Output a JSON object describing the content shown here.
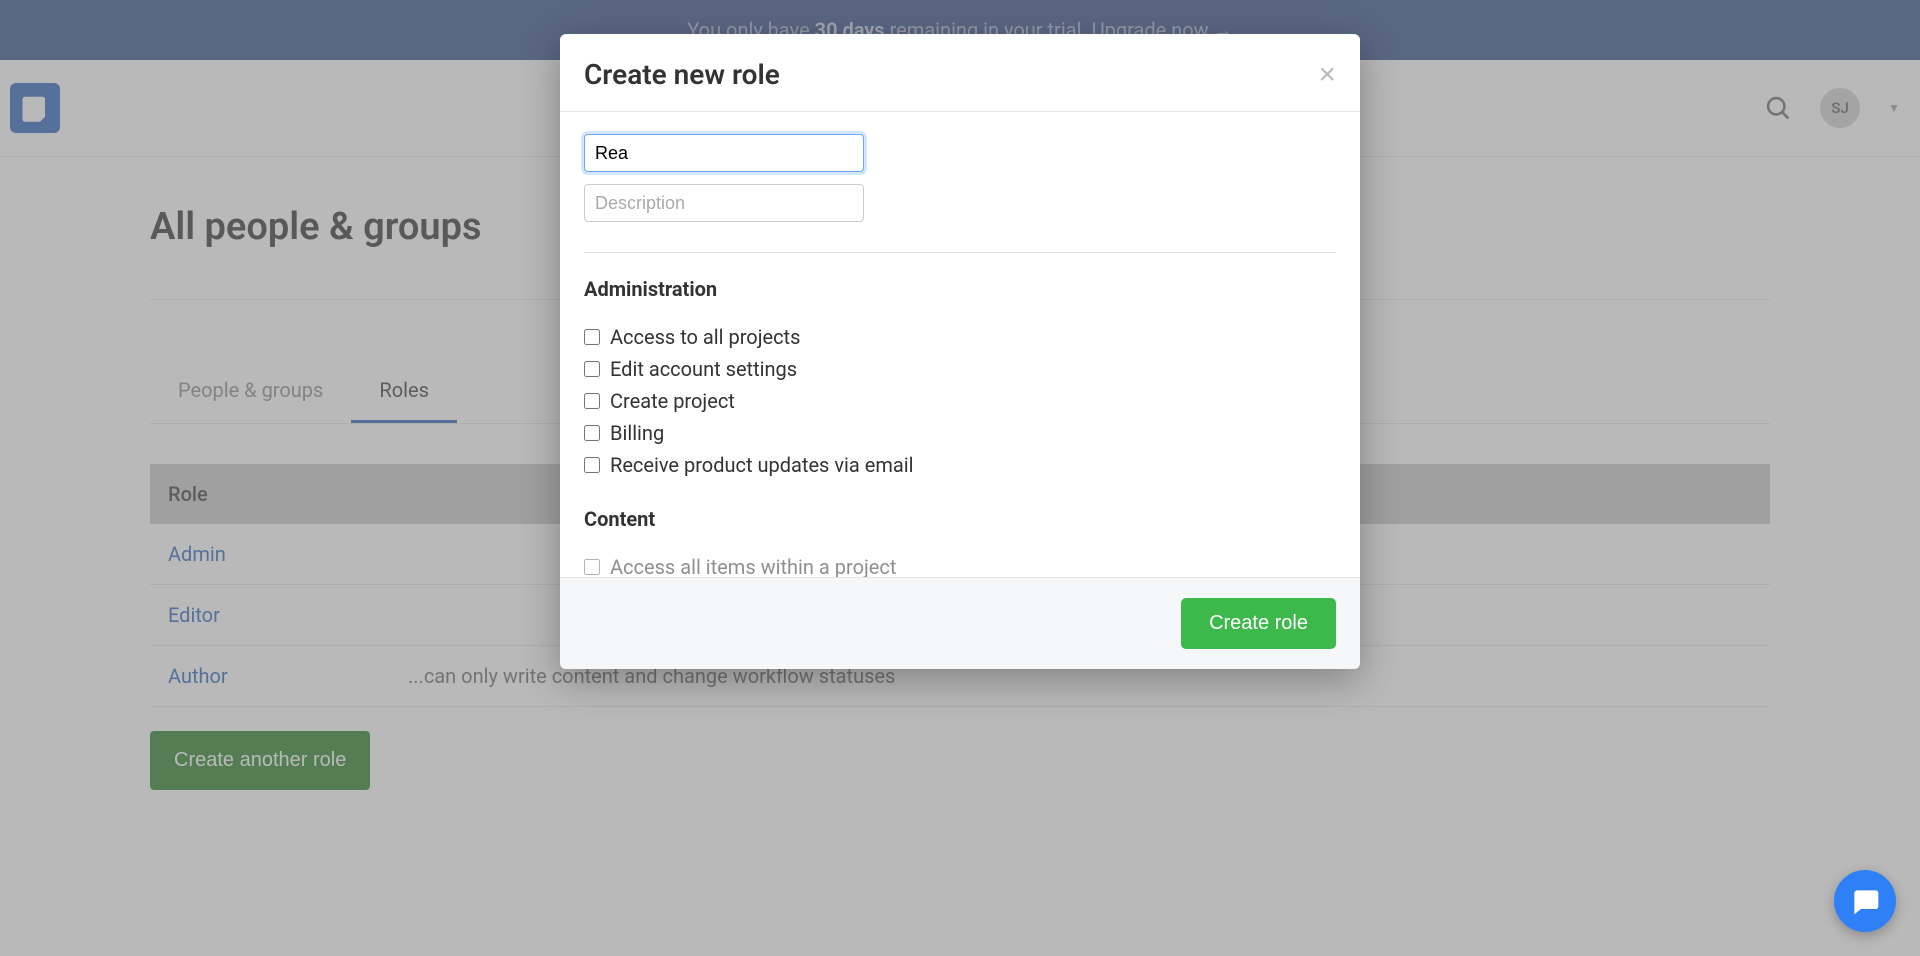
{
  "banner": {
    "prefix": "You only have ",
    "days": "30 days",
    "suffix": " remaining in your trial. ",
    "cta": "Upgrade now",
    "arrow": "→"
  },
  "header": {
    "avatar_initials": "SJ"
  },
  "page": {
    "title": "All people & groups"
  },
  "tabs": [
    {
      "label": "People & groups",
      "active": false
    },
    {
      "label": "Roles",
      "active": true
    }
  ],
  "roles_table": {
    "header": "Role",
    "rows": [
      {
        "name": "Admin",
        "desc": ""
      },
      {
        "name": "Editor",
        "desc": ""
      },
      {
        "name": "Author",
        "desc": "...can only write content and change workflow statuses"
      }
    ]
  },
  "create_another_label": "Create another role",
  "modal": {
    "title": "Create new role",
    "name_value": "Rea",
    "description_placeholder": "Description",
    "sections": {
      "administration": {
        "heading": "Administration",
        "items": [
          "Access to all projects",
          "Edit account settings",
          "Create project",
          "Billing",
          "Receive product updates via email"
        ]
      },
      "content": {
        "heading": "Content",
        "items": [
          "Access all items within a project"
        ]
      }
    },
    "submit_label": "Create role"
  }
}
